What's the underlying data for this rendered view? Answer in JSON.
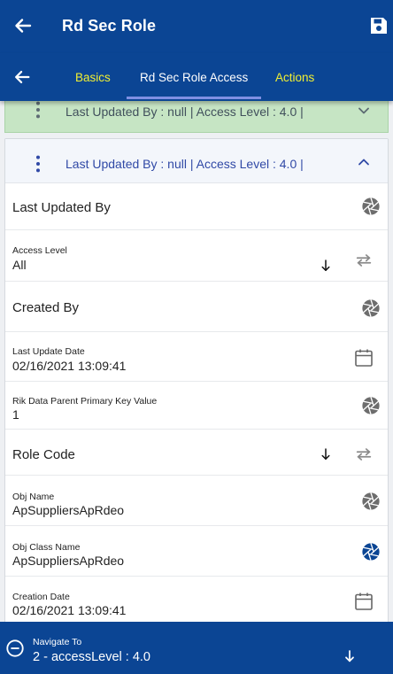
{
  "app_bar": {
    "title": "Rd Sec Role",
    "back_icon": "arrow-left-icon",
    "save_icon": "save-icon",
    "color": "#0b4594"
  },
  "tabs": {
    "back_icon": "arrow-left-icon",
    "items": [
      {
        "label": "Basics",
        "active": false
      },
      {
        "label": "Rd Sec Role Access",
        "active": true
      },
      {
        "label": "Actions",
        "active": false
      }
    ]
  },
  "records": [
    {
      "summary": "Last Updated By  : null | Access Level  : 4.0 |",
      "expanded": false,
      "bg": "#c6e5c4"
    },
    {
      "summary": "Last Updated By  : null | Access Level  : 4.0 |",
      "expanded": true
    }
  ],
  "fields": {
    "last_updated_by": {
      "label": "Last Updated By",
      "icon": "aperture-icon"
    },
    "access_level": {
      "label": "Access Level",
      "value": "All",
      "icons": [
        "sort-down-icon",
        "swap-icon"
      ]
    },
    "created_by": {
      "label": "Created By",
      "icon": "aperture-icon"
    },
    "last_update_date": {
      "label": "Last Update Date",
      "value": "02/16/2021 13:09:41",
      "icon": "calendar-icon"
    },
    "rik_parent_key": {
      "label": "Rik Data Parent Primary Key Value",
      "value": "1",
      "icon": "aperture-icon"
    },
    "role_code": {
      "label": "Role Code",
      "icons": [
        "sort-down-icon",
        "swap-icon"
      ]
    },
    "obj_name": {
      "label": "Obj Name",
      "value": "ApSuppliersApRdeo",
      "icon": "aperture-icon"
    },
    "obj_class_name": {
      "label": "Obj Class Name",
      "value": "ApSuppliersApRdeo",
      "icon": "aperture-icon-blue"
    },
    "creation_date": {
      "label": "Creation Date",
      "value": "02/16/2021 13:09:41",
      "icon": "calendar-icon"
    }
  },
  "bottom_bar": {
    "label": "Navigate To",
    "value": "2 - accessLevel : 4.0",
    "icons": [
      "minus-circle-icon",
      "arrow-down-icon"
    ]
  }
}
